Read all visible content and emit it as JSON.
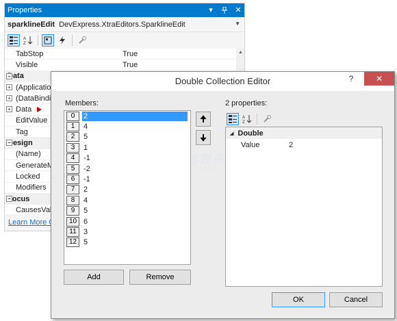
{
  "properties_panel": {
    "title": "Properties",
    "object_name": "sparklineEdit",
    "object_type": "DevExpress.XtraEditors.SparklineEdit",
    "rows": [
      {
        "kind": "prop",
        "name": "TabStop",
        "value": "True"
      },
      {
        "kind": "prop",
        "name": "Visible",
        "value": "True"
      },
      {
        "kind": "cat",
        "name": "Data",
        "value": ""
      },
      {
        "kind": "exp",
        "name": "(ApplicationSettings)",
        "value": ""
      },
      {
        "kind": "exp",
        "name": "(DataBindings)",
        "value": ""
      },
      {
        "kind": "exp",
        "name": "Data",
        "value": ""
      },
      {
        "kind": "prop",
        "name": "EditValue",
        "value": ""
      },
      {
        "kind": "prop",
        "name": "Tag",
        "value": ""
      },
      {
        "kind": "cat",
        "name": "Design",
        "value": ""
      },
      {
        "kind": "prop",
        "name": "(Name)",
        "value": ""
      },
      {
        "kind": "prop",
        "name": "GenerateMember",
        "value": ""
      },
      {
        "kind": "prop",
        "name": "Locked",
        "value": ""
      },
      {
        "kind": "prop",
        "name": "Modifiers",
        "value": ""
      },
      {
        "kind": "cat",
        "name": "Focus",
        "value": ""
      },
      {
        "kind": "prop",
        "name": "CausesValidation",
        "value": ""
      }
    ],
    "link": "Learn More Online"
  },
  "dialog": {
    "title": "Double Collection Editor",
    "help": "?",
    "close": "✕",
    "members_label": "Members:",
    "members": [
      {
        "index": "0",
        "value": "2"
      },
      {
        "index": "1",
        "value": "4"
      },
      {
        "index": "2",
        "value": "5"
      },
      {
        "index": "3",
        "value": "1"
      },
      {
        "index": "4",
        "value": "-1"
      },
      {
        "index": "5",
        "value": "-2"
      },
      {
        "index": "6",
        "value": "-1"
      },
      {
        "index": "7",
        "value": "2"
      },
      {
        "index": "8",
        "value": "4"
      },
      {
        "index": "9",
        "value": "5"
      },
      {
        "index": "10",
        "value": "6"
      },
      {
        "index": "11",
        "value": "3"
      },
      {
        "index": "12",
        "value": "5"
      }
    ],
    "selected_index": 0,
    "add_label": "Add",
    "remove_label": "Remove",
    "properties_label": "2 properties:",
    "property_category": "Double",
    "property_name": "Value",
    "property_value": "2",
    "ok_label": "OK",
    "cancel_label": "Cancel"
  },
  "watermark": {
    "text": "慧都控件网",
    "sub": "WWW.EVGET.COM"
  },
  "colors": {
    "titlebar": "#007acc",
    "selection": "#3399ff",
    "close": "#c75050",
    "link": "#1e6fbf"
  }
}
